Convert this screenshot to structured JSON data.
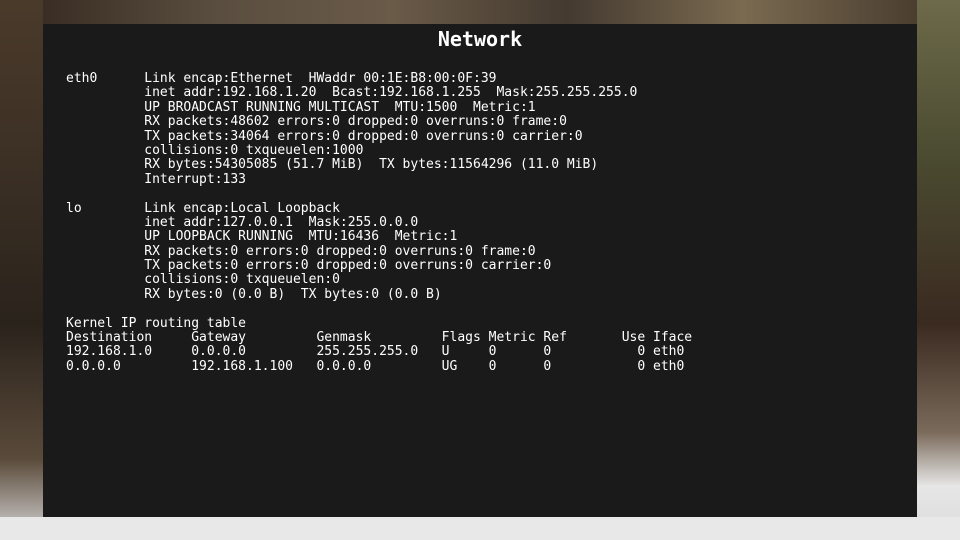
{
  "window": {
    "title": "Network"
  },
  "interfaces": [
    {
      "name": "eth0",
      "lines": [
        "Link encap:Ethernet  HWaddr 00:1E:B8:00:0F:39",
        "inet addr:192.168.1.20  Bcast:192.168.1.255  Mask:255.255.255.0",
        "UP BROADCAST RUNNING MULTICAST  MTU:1500  Metric:1",
        "RX packets:48602 errors:0 dropped:0 overruns:0 frame:0",
        "TX packets:34064 errors:0 dropped:0 overruns:0 carrier:0",
        "collisions:0 txqueuelen:1000",
        "RX bytes:54305085 (51.7 MiB)  TX bytes:11564296 (11.0 MiB)",
        "Interrupt:133"
      ]
    },
    {
      "name": "lo",
      "lines": [
        "Link encap:Local Loopback",
        "inet addr:127.0.0.1  Mask:255.0.0.0",
        "UP LOOPBACK RUNNING  MTU:16436  Metric:1",
        "RX packets:0 errors:0 dropped:0 overruns:0 frame:0",
        "TX packets:0 errors:0 dropped:0 overruns:0 carrier:0",
        "collisions:0 txqueuelen:0",
        "RX bytes:0 (0.0 B)  TX bytes:0 (0.0 B)"
      ]
    }
  ],
  "routing": {
    "title": "Kernel IP routing table",
    "headers": [
      "Destination",
      "Gateway",
      "Genmask",
      "Flags",
      "Metric",
      "Ref",
      "Use",
      "Iface"
    ],
    "rows": [
      [
        "192.168.1.0",
        "0.0.0.0",
        "255.255.255.0",
        "U",
        "0",
        "0",
        "0",
        "eth0"
      ],
      [
        "0.0.0.0",
        "192.168.1.100",
        "0.0.0.0",
        "UG",
        "0",
        "0",
        "0",
        "eth0"
      ]
    ]
  }
}
